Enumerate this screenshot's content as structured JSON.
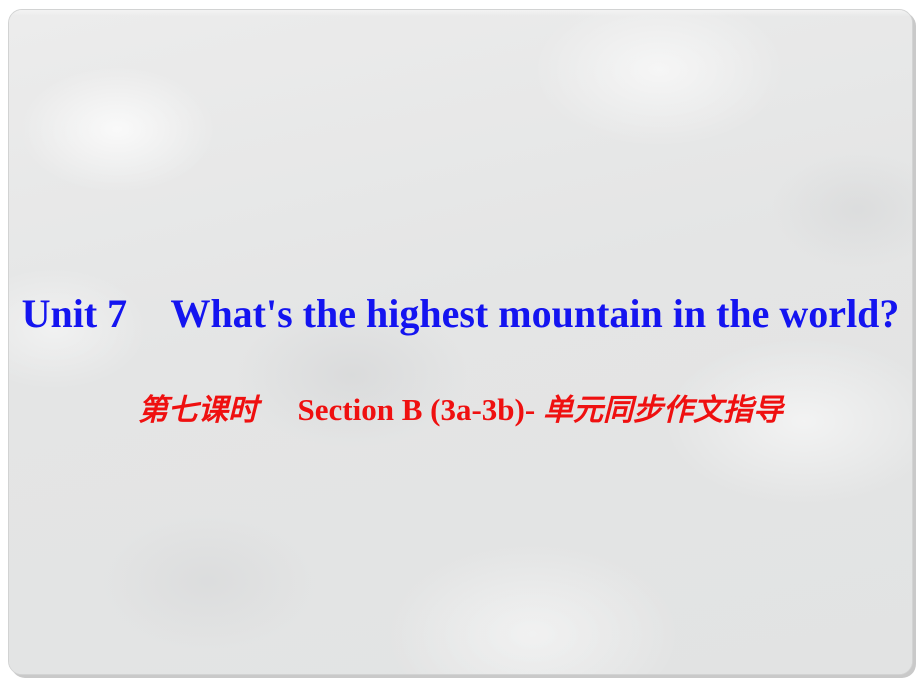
{
  "slide": {
    "background_color": "#e5e6e6",
    "border_color": "#d2d3d3",
    "title": {
      "unit_label": "Unit 7",
      "question": "What's the highest mountain in the world?",
      "full_text": "Unit 7　What's the highest mountain in the world?",
      "color": "#1414f0"
    },
    "subtitle": {
      "period_label": "第七课时",
      "section_label": "Section B (3a-3b)-",
      "topic_label": "单元同步作文指导",
      "full_text": "第七课时　Section B (3a-3b)-单元同步作文指导",
      "color": "#ef1010"
    }
  }
}
